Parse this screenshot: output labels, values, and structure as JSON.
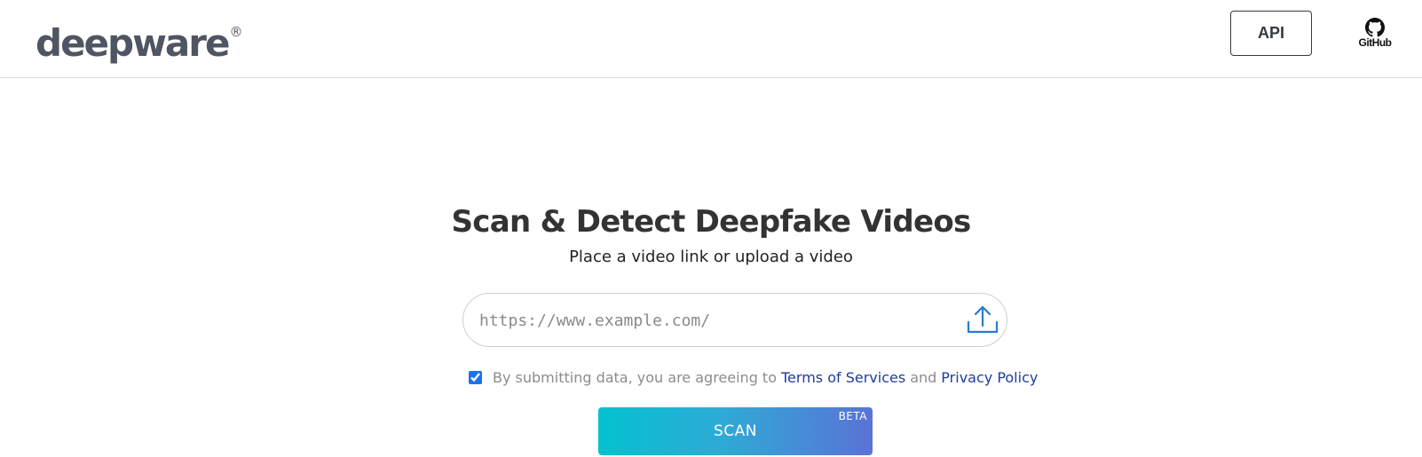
{
  "header": {
    "logo_text": "deepware",
    "logo_mark": "®",
    "api_label": "API",
    "github_label": "GitHub"
  },
  "hero": {
    "title": "Scan & Detect Deepfake Videos",
    "subtitle": "Place a video link or upload a video"
  },
  "url_input": {
    "placeholder": "https://www.example.com/",
    "value": ""
  },
  "agreement": {
    "checked": true,
    "text": "By submitting data, you are agreeing to",
    "terms_link": "Terms of Services",
    "and_text": "and",
    "privacy_link": "Privacy Policy"
  },
  "scan_button": {
    "label": "SCAN",
    "badge": "BETA"
  },
  "icons": {
    "github": "github-icon",
    "upload": "upload-icon"
  },
  "colors": {
    "logo": "#505563",
    "link": "#1e3d9e",
    "upload_icon": "#2a7bd0",
    "scan_gradient_start": "#03c2d0",
    "scan_gradient_end": "#5a72d6"
  }
}
